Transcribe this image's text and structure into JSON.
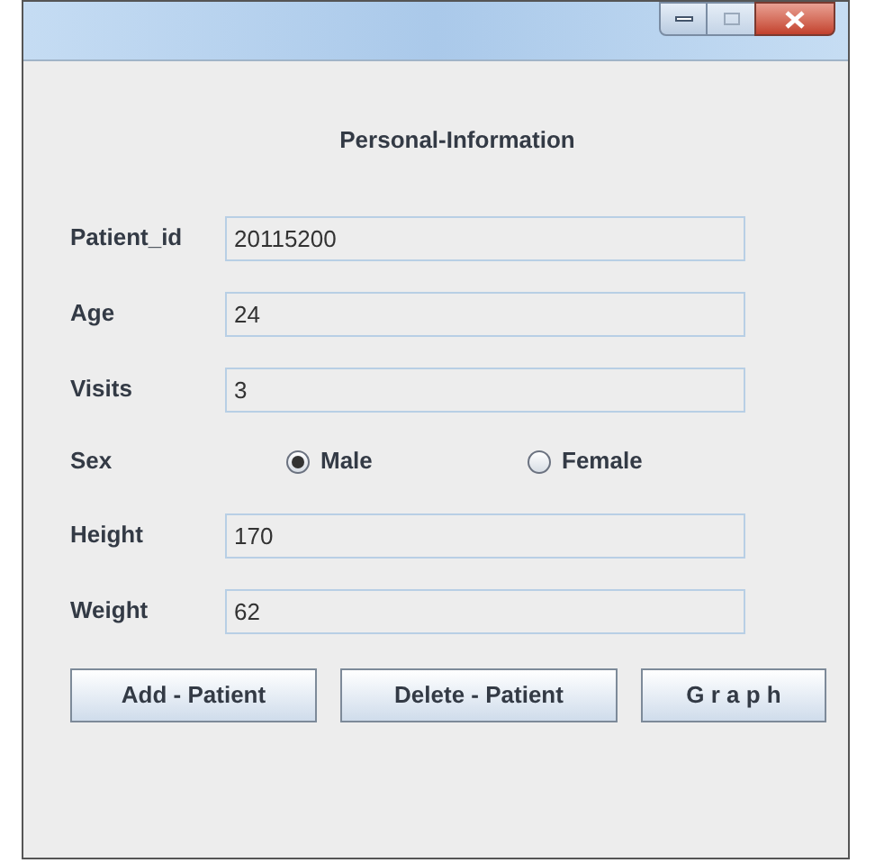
{
  "window": {
    "title_buttons": [
      {
        "kind": "minimize"
      },
      {
        "kind": "maximize"
      },
      {
        "kind": "close"
      }
    ]
  },
  "heading": "Personal-Information",
  "rows": [
    {
      "kind": "text",
      "label": "Patient_id",
      "value": "20115200"
    },
    {
      "kind": "text",
      "label": "Age",
      "value": "24"
    },
    {
      "kind": "text",
      "label": "Visits",
      "value": "3"
    },
    {
      "kind": "radio",
      "label": "Sex",
      "options": [
        {
          "label": "Male",
          "selected": true
        },
        {
          "label": "Female",
          "selected": false
        }
      ]
    },
    {
      "kind": "text",
      "label": "Height",
      "value": "170"
    },
    {
      "kind": "text",
      "label": "Weight",
      "value": "62"
    }
  ],
  "buttons": [
    "Add - Patient",
    "Delete - Patient",
    "G r a p h"
  ]
}
